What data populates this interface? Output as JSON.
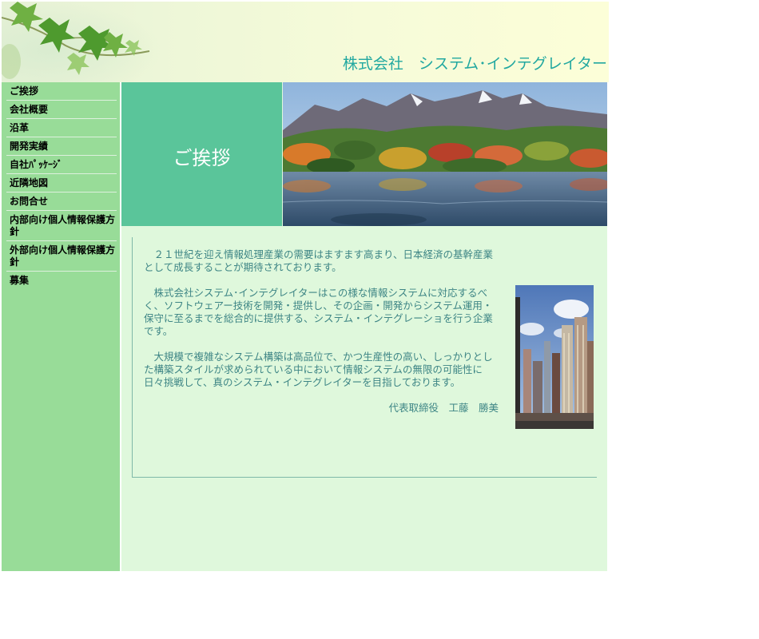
{
  "header": {
    "company_name": "株式会社　システム･インテグレイター"
  },
  "sidebar": {
    "items": [
      {
        "label": "ご挨拶"
      },
      {
        "label": "会社概要"
      },
      {
        "label": "沿革"
      },
      {
        "label": "開発実績"
      },
      {
        "label": "自社ﾊﾟｯｹｰｼﾞ"
      },
      {
        "label": "近隣地図"
      },
      {
        "label": "お問合せ"
      },
      {
        "label": "内部向け個人情報保護方針"
      },
      {
        "label": "外部向け個人情報保護方針"
      },
      {
        "label": "募集"
      }
    ]
  },
  "main": {
    "title": "ご挨拶",
    "paragraphs": [
      "　２１世紀を迎え情報処理産業の需要はますます高まり、日本経済の基幹産業として成長することが期待されております。",
      "　株式会社システム･インテグレイターはこの様な情報システムに対応するべく、ソフトウェアー技術を開発・提供し、その企画・開発からシステム運用・保守に至るまでを総合的に提供する、システム・インテグレーショを行う企業です。",
      "　大規模で複雑なシステム構築は高品位で、かつ生産性の高い、しっかりとした構築スタイルが求められている中において情報システムの無限の可能性に日々挑戦して、真のシステム・インテグレイターを目指しております。"
    ],
    "signature": "代表取締役　工藤　勝美"
  },
  "colors": {
    "sidebar": "#98dc98",
    "main_bg": "#dff8dc",
    "title_block": "#5ac59a",
    "company_text": "#22a8a0",
    "body_text": "#3d8585"
  }
}
